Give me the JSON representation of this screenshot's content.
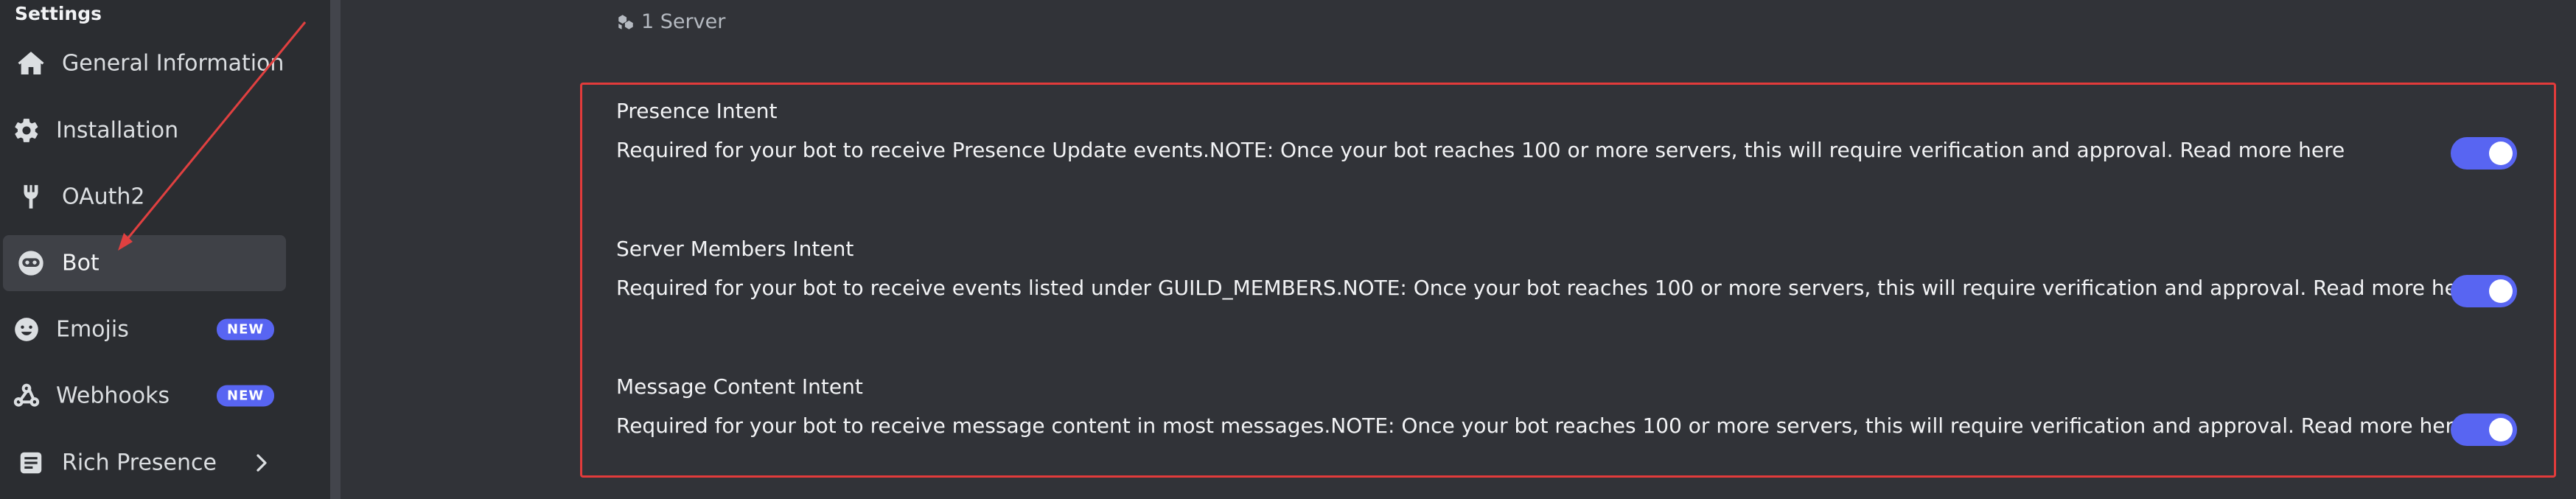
{
  "sidebar": {
    "heading": "Settings",
    "items": [
      {
        "label": "General Information",
        "icon": "home-icon"
      },
      {
        "label": "Installation",
        "icon": "gear-icon"
      },
      {
        "label": "OAuth2",
        "icon": "wrench-icon"
      },
      {
        "label": "Bot",
        "icon": "bot-icon",
        "active": true
      },
      {
        "label": "Emojis",
        "icon": "smiley-icon",
        "badge": "NEW"
      },
      {
        "label": "Webhooks",
        "icon": "webhook-icon",
        "badge": "NEW"
      },
      {
        "label": "Rich Presence",
        "icon": "document-icon",
        "chevron": true
      }
    ]
  },
  "main": {
    "server_count": "1 Server",
    "intents": [
      {
        "title": "Presence Intent",
        "description": "Required for your bot to receive Presence Update events.NOTE: Once your bot reaches 100 or more servers, this will require verification and approval. Read more here",
        "enabled": true
      },
      {
        "title": "Server Members Intent",
        "description": "Required for your bot to receive events listed under GUILD_MEMBERS.NOTE: Once your bot reaches 100 or more servers, this will require verification and approval. Read more here",
        "enabled": true
      },
      {
        "title": "Message Content Intent",
        "description": "Required for your bot to receive message content in most messages.NOTE: Once your bot reaches 100 or more servers, this will require verification and approval. Read more here",
        "enabled": true
      }
    ]
  },
  "colors": {
    "accent": "#5865f2",
    "highlight_border": "#e23b3b",
    "annotation_arrow": "#e04040"
  }
}
